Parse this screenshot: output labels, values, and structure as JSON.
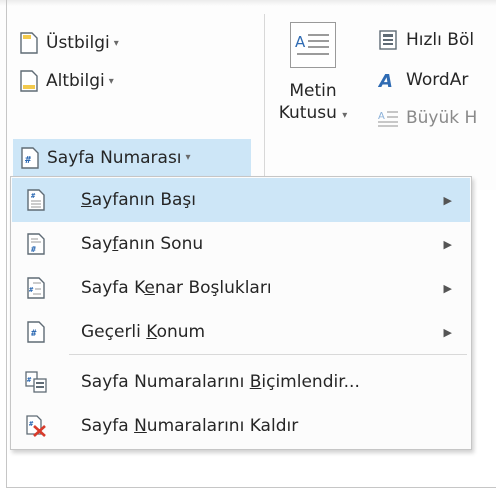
{
  "ribbon": {
    "header_label": "Üstbilgi",
    "footer_label": "Altbilgi",
    "page_number_label": "Sayfa Numarası",
    "textbox_line1": "Metin",
    "textbox_line2": "Kutusu",
    "quick_parts_label": "Hızlı Böl",
    "wordart_label": "WordAr",
    "dropcap_label": "Büyük H",
    "dropdown_glyph": "▾"
  },
  "menu": {
    "items": [
      {
        "pre": "",
        "u": "S",
        "post": "ayfanın Başı",
        "submenu": true,
        "highlighted": true,
        "icon": "page-top-icon"
      },
      {
        "pre": "Say",
        "u": "f",
        "post": "anın Sonu",
        "submenu": true,
        "highlighted": false,
        "icon": "page-bottom-icon"
      },
      {
        "pre": "Sayfa K",
        "u": "e",
        "post": "nar Boşlukları",
        "submenu": true,
        "highlighted": false,
        "icon": "page-margins-icon"
      },
      {
        "pre": "Geçerli ",
        "u": "K",
        "post": "onum",
        "submenu": true,
        "highlighted": false,
        "icon": "current-position-icon"
      },
      {
        "pre": "Sayfa Numaralarını ",
        "u": "B",
        "post": "içimlendir...",
        "submenu": false,
        "highlighted": false,
        "icon": "format-page-numbers-icon"
      },
      {
        "pre": "Sayfa ",
        "u": "N",
        "post": "umaralarını Kaldır",
        "submenu": false,
        "highlighted": false,
        "icon": "remove-page-numbers-icon"
      }
    ],
    "submenu_arrow": "▶"
  },
  "colors": {
    "highlight": "#cde6f7",
    "accent_blue": "#2f6bb3",
    "remove_red": "#d83b2b",
    "footer_yellow": "#f2c94c"
  }
}
